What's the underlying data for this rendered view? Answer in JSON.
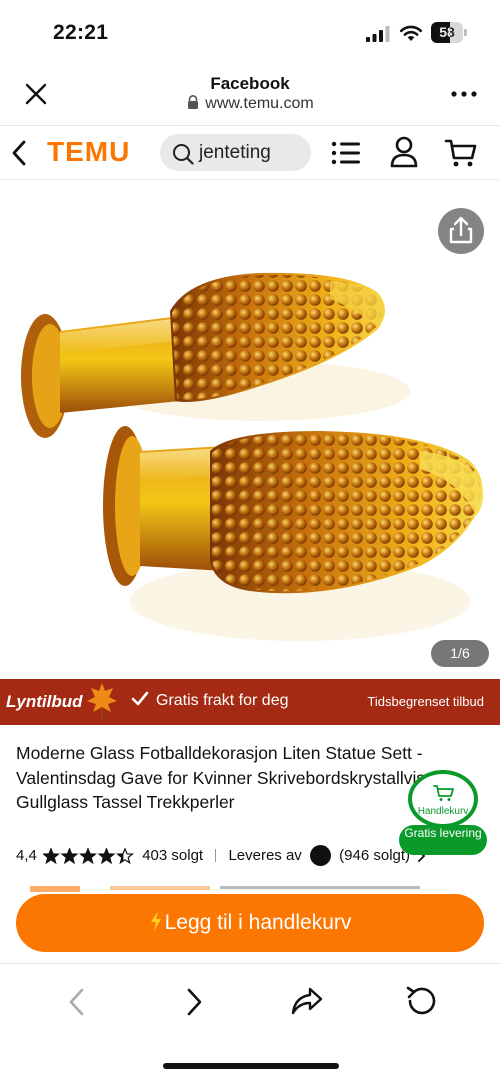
{
  "status_bar": {
    "time": "22:21",
    "battery_level": "58",
    "battery_fraction": 0.58
  },
  "browser": {
    "title": "Facebook",
    "url": "www.temu.com",
    "close_icon": "close-icon",
    "more_icon": "more-icon"
  },
  "header": {
    "logo": "TEMU",
    "search_query": "jenteting",
    "brand_color": "#fb7701"
  },
  "gallery": {
    "page_indicator": "1/6",
    "image_description_icon": "product-photo"
  },
  "flash_banner": {
    "label": "Lyntilbud",
    "free_shipping": "Gratis frakt for deg",
    "limited_offer": "Tidsbegrenset tilbud",
    "color": "#a52a13"
  },
  "product": {
    "title": "Moderne Glass Fotballdekorasjon Liten Statue Sett - Valentinsdag Gave for Kvinner Skrivebordskrystallvisning Gullglass Tassel Trekkperler",
    "rating": "4,4",
    "rating_value": 4.4,
    "sold": "403 solgt",
    "delivered_by": "Leveres av",
    "seller_sold": "(946 solgt)"
  },
  "cart_badge": {
    "label": "Handlekurv",
    "free_delivery": "Gratis levering",
    "color": "#0a9a2a"
  },
  "cta": {
    "add_to_cart": "Legg til i handlekurv"
  }
}
